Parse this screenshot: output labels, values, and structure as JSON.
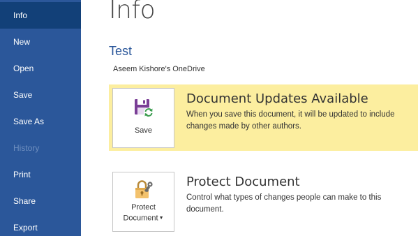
{
  "sidebar": {
    "items": [
      {
        "label": "Info",
        "state": "active"
      },
      {
        "label": "New",
        "state": "normal"
      },
      {
        "label": "Open",
        "state": "normal"
      },
      {
        "label": "Save",
        "state": "normal"
      },
      {
        "label": "Save As",
        "state": "normal"
      },
      {
        "label": "History",
        "state": "disabled"
      },
      {
        "label": "Print",
        "state": "normal"
      },
      {
        "label": "Share",
        "state": "normal"
      },
      {
        "label": "Export",
        "state": "normal"
      }
    ]
  },
  "main": {
    "title": "Info",
    "document_name": "Test",
    "location": "Aseem Kishore's OneDrive",
    "updates": {
      "button_label": "Save",
      "heading": "Document Updates Available",
      "description": "When you save this document, it will be updated to include changes made by other authors."
    },
    "protect": {
      "button_label_line1": "Protect",
      "button_label_line2": "Document",
      "heading": "Protect Document",
      "description": "Control what types of changes people can make to this document."
    }
  },
  "colors": {
    "sidebar_bg": "#2b579a",
    "sidebar_active": "#124078",
    "accent": "#2b579a",
    "highlight_panel": "#fcee9f"
  },
  "icons": {
    "save_tile": "save-sync-icon",
    "protect_tile": "lock-key-icon"
  }
}
